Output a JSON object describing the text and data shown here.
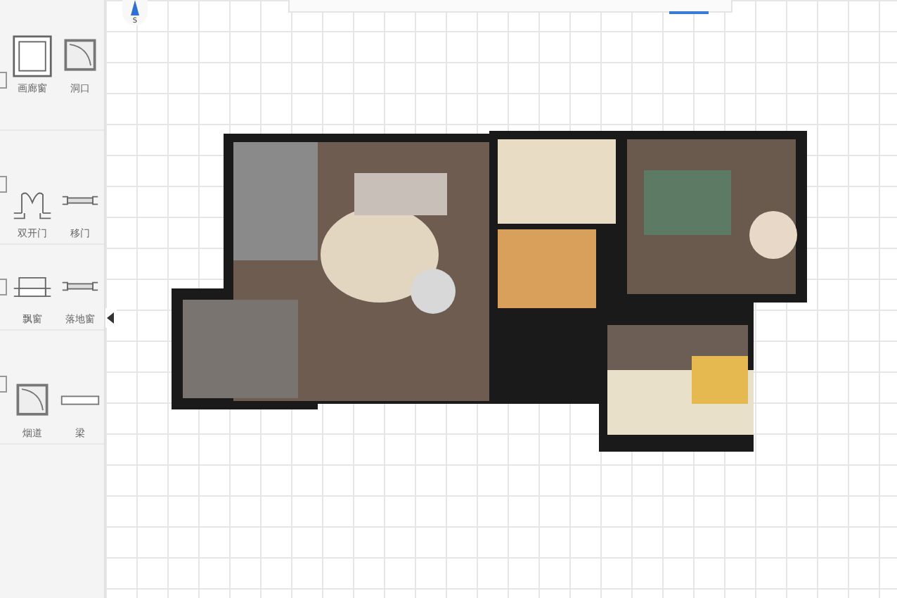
{
  "compass": {
    "label": "S"
  },
  "palette": {
    "sections": [
      {
        "items": [
          {
            "kind": "window-frame",
            "label": "画廊窗"
          },
          {
            "kind": "arc-square",
            "label": "洞口"
          }
        ]
      },
      {
        "items": [
          {
            "kind": "double-door",
            "label": "双开门"
          },
          {
            "kind": "sliding",
            "label": "移门"
          }
        ]
      },
      {
        "items": [
          {
            "kind": "bay",
            "label": "飘窗"
          },
          {
            "kind": "sliding",
            "label": "落地窗"
          }
        ]
      },
      {
        "items": [
          {
            "kind": "arc-square",
            "label": "烟道"
          },
          {
            "kind": "beam",
            "label": "梁"
          }
        ]
      }
    ]
  }
}
